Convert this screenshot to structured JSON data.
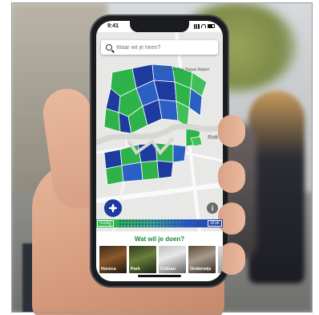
{
  "status_bar": {
    "time": "9:41"
  },
  "search": {
    "placeholder": "Waar wil je heen?"
  },
  "map": {
    "area_label": "Rotterdam The Hague Airport",
    "city_label": "Rott"
  },
  "legend": {
    "low_label": "rustig",
    "high_label": "druk"
  },
  "activities": {
    "title": "Wat wil je doen?",
    "items": [
      {
        "label": "Horeca"
      },
      {
        "label": "Park"
      },
      {
        "label": "Cultuur"
      },
      {
        "label": "Onderwijs"
      }
    ]
  },
  "colors": {
    "quiet_green": "#2db34a",
    "busy_blue": "#1d3a9e",
    "title_green": "#1a8a3a"
  }
}
